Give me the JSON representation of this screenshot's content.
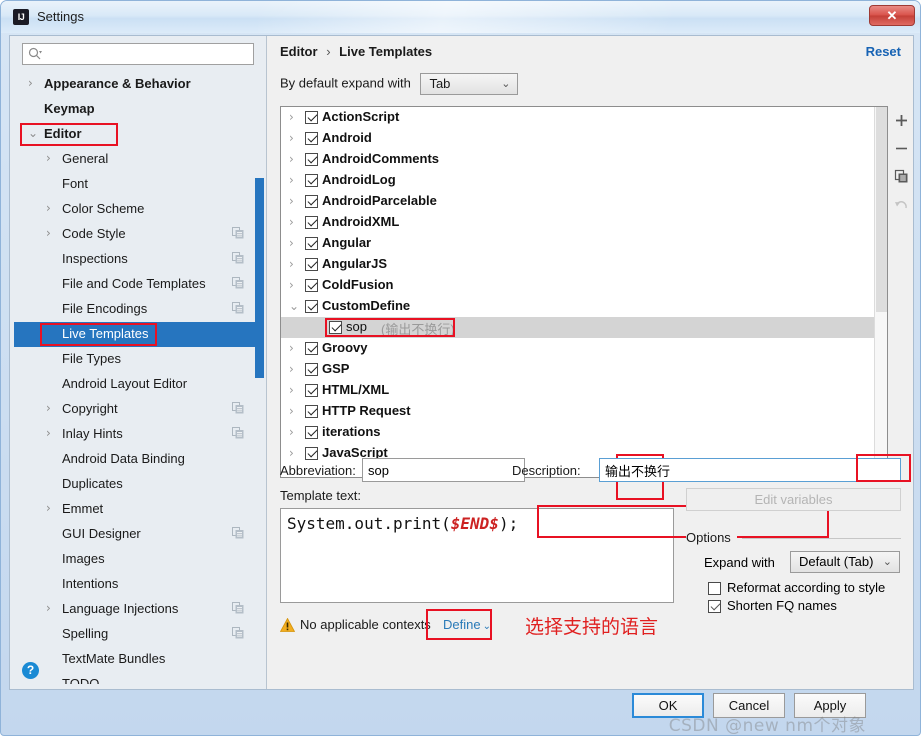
{
  "window": {
    "title": "Settings",
    "app_icon": "IJ",
    "close_label": "✕"
  },
  "search": {
    "placeholder": "",
    "value": "",
    "icon": "search-icon"
  },
  "sidebar": {
    "items": [
      {
        "label": "Appearance & Behavior",
        "level": 0,
        "arrow": "›",
        "copy": false,
        "selected": false
      },
      {
        "label": "Keymap",
        "level": 0,
        "arrow": "",
        "copy": false,
        "selected": false
      },
      {
        "label": "Editor",
        "level": 0,
        "arrow": "⌄",
        "copy": false,
        "selected": false,
        "redbox": true
      },
      {
        "label": "General",
        "level": 1,
        "arrow": "›",
        "copy": false,
        "selected": false
      },
      {
        "label": "Font",
        "level": 1,
        "arrow": "",
        "copy": false,
        "selected": false
      },
      {
        "label": "Color Scheme",
        "level": 1,
        "arrow": "›",
        "copy": false,
        "selected": false
      },
      {
        "label": "Code Style",
        "level": 1,
        "arrow": "›",
        "copy": true,
        "selected": false
      },
      {
        "label": "Inspections",
        "level": 1,
        "arrow": "",
        "copy": true,
        "selected": false
      },
      {
        "label": "File and Code Templates",
        "level": 1,
        "arrow": "",
        "copy": true,
        "selected": false
      },
      {
        "label": "File Encodings",
        "level": 1,
        "arrow": "",
        "copy": true,
        "selected": false
      },
      {
        "label": "Live Templates",
        "level": 1,
        "arrow": "",
        "copy": false,
        "selected": true,
        "redbox": true
      },
      {
        "label": "File Types",
        "level": 1,
        "arrow": "",
        "copy": false,
        "selected": false
      },
      {
        "label": "Android Layout Editor",
        "level": 1,
        "arrow": "",
        "copy": false,
        "selected": false
      },
      {
        "label": "Copyright",
        "level": 1,
        "arrow": "›",
        "copy": true,
        "selected": false
      },
      {
        "label": "Inlay Hints",
        "level": 1,
        "arrow": "›",
        "copy": true,
        "selected": false
      },
      {
        "label": "Android Data Binding",
        "level": 1,
        "arrow": "",
        "copy": false,
        "selected": false
      },
      {
        "label": "Duplicates",
        "level": 1,
        "arrow": "",
        "copy": false,
        "selected": false
      },
      {
        "label": "Emmet",
        "level": 1,
        "arrow": "›",
        "copy": false,
        "selected": false
      },
      {
        "label": "GUI Designer",
        "level": 1,
        "arrow": "",
        "copy": true,
        "selected": false
      },
      {
        "label": "Images",
        "level": 1,
        "arrow": "",
        "copy": false,
        "selected": false
      },
      {
        "label": "Intentions",
        "level": 1,
        "arrow": "",
        "copy": false,
        "selected": false
      },
      {
        "label": "Language Injections",
        "level": 1,
        "arrow": "›",
        "copy": true,
        "selected": false
      },
      {
        "label": "Spelling",
        "level": 1,
        "arrow": "",
        "copy": true,
        "selected": false
      },
      {
        "label": "TextMate Bundles",
        "level": 1,
        "arrow": "",
        "copy": false,
        "selected": false
      },
      {
        "label": "TODO",
        "level": 1,
        "arrow": "",
        "copy": false,
        "selected": false
      }
    ],
    "help_label": "?"
  },
  "main": {
    "breadcrumb_root": "Editor",
    "breadcrumb_sep": "›",
    "breadcrumb_leaf": "Live Templates",
    "reset_label": "Reset",
    "expand_with_label": "By default expand with",
    "expand_with_value": "Tab",
    "templates": [
      {
        "label": "ActionScript",
        "level": 0,
        "expanded": false,
        "checked": true,
        "selected": false,
        "desc": ""
      },
      {
        "label": "Android",
        "level": 0,
        "expanded": false,
        "checked": true,
        "selected": false,
        "desc": ""
      },
      {
        "label": "AndroidComments",
        "level": 0,
        "expanded": false,
        "checked": true,
        "selected": false,
        "desc": ""
      },
      {
        "label": "AndroidLog",
        "level": 0,
        "expanded": false,
        "checked": true,
        "selected": false,
        "desc": ""
      },
      {
        "label": "AndroidParcelable",
        "level": 0,
        "expanded": false,
        "checked": true,
        "selected": false,
        "desc": ""
      },
      {
        "label": "AndroidXML",
        "level": 0,
        "expanded": false,
        "checked": true,
        "selected": false,
        "desc": ""
      },
      {
        "label": "Angular",
        "level": 0,
        "expanded": false,
        "checked": true,
        "selected": false,
        "desc": ""
      },
      {
        "label": "AngularJS",
        "level": 0,
        "expanded": false,
        "checked": true,
        "selected": false,
        "desc": ""
      },
      {
        "label": "ColdFusion",
        "level": 0,
        "expanded": false,
        "checked": true,
        "selected": false,
        "desc": ""
      },
      {
        "label": "CustomDefine",
        "level": 0,
        "expanded": true,
        "checked": true,
        "selected": false,
        "desc": ""
      },
      {
        "label": "sop",
        "level": 1,
        "expanded": false,
        "checked": true,
        "selected": true,
        "desc": "(输出不换行)",
        "redbox": true
      },
      {
        "label": "Groovy",
        "level": 0,
        "expanded": false,
        "checked": true,
        "selected": false,
        "desc": ""
      },
      {
        "label": "GSP",
        "level": 0,
        "expanded": false,
        "checked": true,
        "selected": false,
        "desc": ""
      },
      {
        "label": "HTML/XML",
        "level": 0,
        "expanded": false,
        "checked": true,
        "selected": false,
        "desc": ""
      },
      {
        "label": "HTTP Request",
        "level": 0,
        "expanded": false,
        "checked": true,
        "selected": false,
        "desc": ""
      },
      {
        "label": "iterations",
        "level": 0,
        "expanded": false,
        "checked": true,
        "selected": false,
        "desc": ""
      },
      {
        "label": "JavaScript",
        "level": 0,
        "expanded": false,
        "checked": true,
        "selected": false,
        "desc": ""
      }
    ],
    "toolbar": {
      "add": "add-icon",
      "remove": "remove-icon",
      "duplicate": "duplicate-icon",
      "revert": "revert-icon"
    },
    "abbreviation_label": "Abbreviation:",
    "abbreviation_value": "sop",
    "description_label": "Description:",
    "description_value": "输出不换行",
    "template_text_label": "Template text:",
    "template_text_prefix": "System.out.print(",
    "template_text_variable": "$END$",
    "template_text_suffix": ");",
    "edit_variables_label": "Edit variables",
    "options": {
      "legend": "Options",
      "expand_with_label": "Expand with",
      "expand_with_value": "Default (Tab)",
      "reformat_label": "Reformat according to style",
      "reformat_checked": false,
      "shorten_label": "Shorten FQ names",
      "shorten_checked": true
    },
    "warning_text": "No applicable contexts",
    "define_label": "Define",
    "define_caret": "⌄",
    "annotation_chinese": "选择支持的语言"
  },
  "footer": {
    "ok": "OK",
    "cancel": "Cancel",
    "apply": "Apply",
    "watermark": "CSDN @new nm个对象"
  },
  "colors": {
    "selection_blue": "#2675bf",
    "link_blue": "#1763b4",
    "annotation_red": "#e02020",
    "redbox": "#e81123"
  }
}
